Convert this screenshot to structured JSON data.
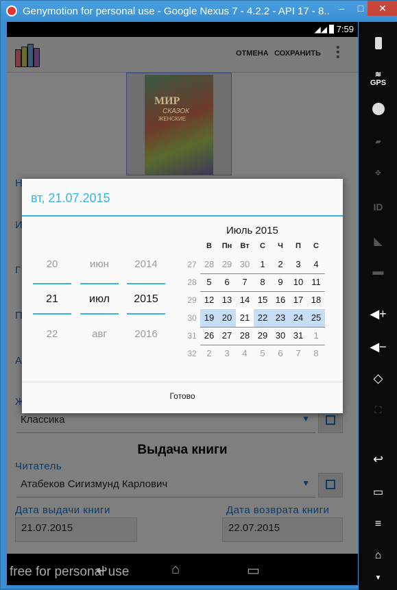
{
  "window": {
    "title": "Genymotion for personal use - Google Nexus 7 - 4.2.2 - API 17 - 8...",
    "min": "–",
    "max": "□",
    "close": "✕"
  },
  "status": {
    "time": "7:59"
  },
  "actionbar": {
    "cancel": "ОТМЕНА",
    "save": "СОХРАНИТЬ"
  },
  "cover": {
    "line1": "МИР",
    "line2": "СКАЗОК",
    "line3": "ЖЕНСКИЕ"
  },
  "form": {
    "genre_label_partial": "Ж",
    "genre_value": "Классика",
    "issue_section": "Выдача книги",
    "reader_label": "Читатель",
    "reader_value": "Атабеков Сигизмунд Карлович",
    "issue_date_label": "Дата выдачи книги",
    "issue_date": "21.07.2015",
    "return_date_label": "Дата возврата книги",
    "return_date": "22.07.2015",
    "side_letters": [
      "Н",
      "И",
      "Г",
      "П",
      "А"
    ]
  },
  "dialog": {
    "title": "вт, 21.07.2015",
    "day": {
      "prev": "20",
      "cur": "21",
      "next": "22"
    },
    "month": {
      "prev": "июн",
      "cur": "июл",
      "next": "авг"
    },
    "year": {
      "prev": "2014",
      "cur": "2015",
      "next": "2016"
    },
    "calendar_title": "Июль 2015",
    "weekdays": [
      "В",
      "Пн",
      "Вт",
      "С",
      "Ч",
      "П",
      "С"
    ],
    "weeks": [
      {
        "wk": "27",
        "days": [
          "28",
          "29",
          "30",
          "1",
          "2",
          "3",
          "4"
        ],
        "out": [
          true,
          true,
          true,
          false,
          false,
          false,
          false
        ]
      },
      {
        "wk": "28",
        "days": [
          "5",
          "6",
          "7",
          "8",
          "9",
          "10",
          "11"
        ],
        "out": [
          false,
          false,
          false,
          false,
          false,
          false,
          false
        ]
      },
      {
        "wk": "29",
        "days": [
          "12",
          "13",
          "14",
          "15",
          "16",
          "17",
          "18"
        ],
        "out": [
          false,
          false,
          false,
          false,
          false,
          false,
          false
        ]
      },
      {
        "wk": "30",
        "days": [
          "19",
          "20",
          "21",
          "22",
          "23",
          "24",
          "25"
        ],
        "out": [
          false,
          false,
          false,
          false,
          false,
          false,
          false
        ]
      },
      {
        "wk": "31",
        "days": [
          "26",
          "27",
          "28",
          "29",
          "30",
          "31",
          "1"
        ],
        "out": [
          false,
          false,
          false,
          false,
          false,
          false,
          true
        ]
      },
      {
        "wk": "32",
        "days": [
          "2",
          "3",
          "4",
          "5",
          "6",
          "7",
          "8"
        ],
        "out": [
          true,
          true,
          true,
          true,
          true,
          true,
          true
        ]
      }
    ],
    "done": "Готово"
  },
  "watermark": "free for personal use",
  "panel": {
    "gps": "GPS",
    "id": "ID"
  },
  "colors": {
    "accent": "#33b5e5",
    "selected_week": "#c7dcf5",
    "titlebar": "#3a8ed4"
  }
}
